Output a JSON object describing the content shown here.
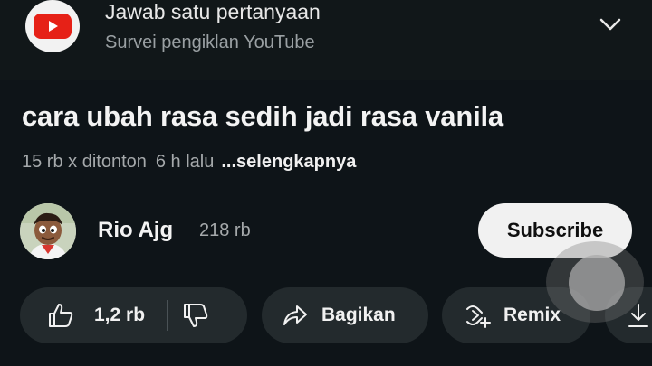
{
  "survey": {
    "title": "Jawab satu pertanyaan",
    "subtitle": "Survei pengiklan YouTube",
    "icons": {
      "logo": "youtube-logo-icon",
      "expand": "chevron-down-icon"
    }
  },
  "video": {
    "title": "cara ubah rasa sedih jadi rasa vanila",
    "views": "15 rb x ditonton",
    "age": "6 h lalu",
    "more_label": "...selengkapnya"
  },
  "channel": {
    "name": "Rio Ajg",
    "subscribers": "218 rb",
    "subscribe_label": "Subscribe"
  },
  "actions": {
    "like_count": "1,2 rb",
    "share_label": "Bagikan",
    "remix_label": "Remix",
    "icons": [
      "thumbs-up-icon",
      "thumbs-down-icon",
      "share-arrow-icon",
      "remix-icon",
      "download-icon"
    ]
  },
  "colors": {
    "background": "#0e1418",
    "youtube_red": "#e62117",
    "pill_bg": "#232a2d",
    "subscribe_bg": "#f1f1f1"
  }
}
